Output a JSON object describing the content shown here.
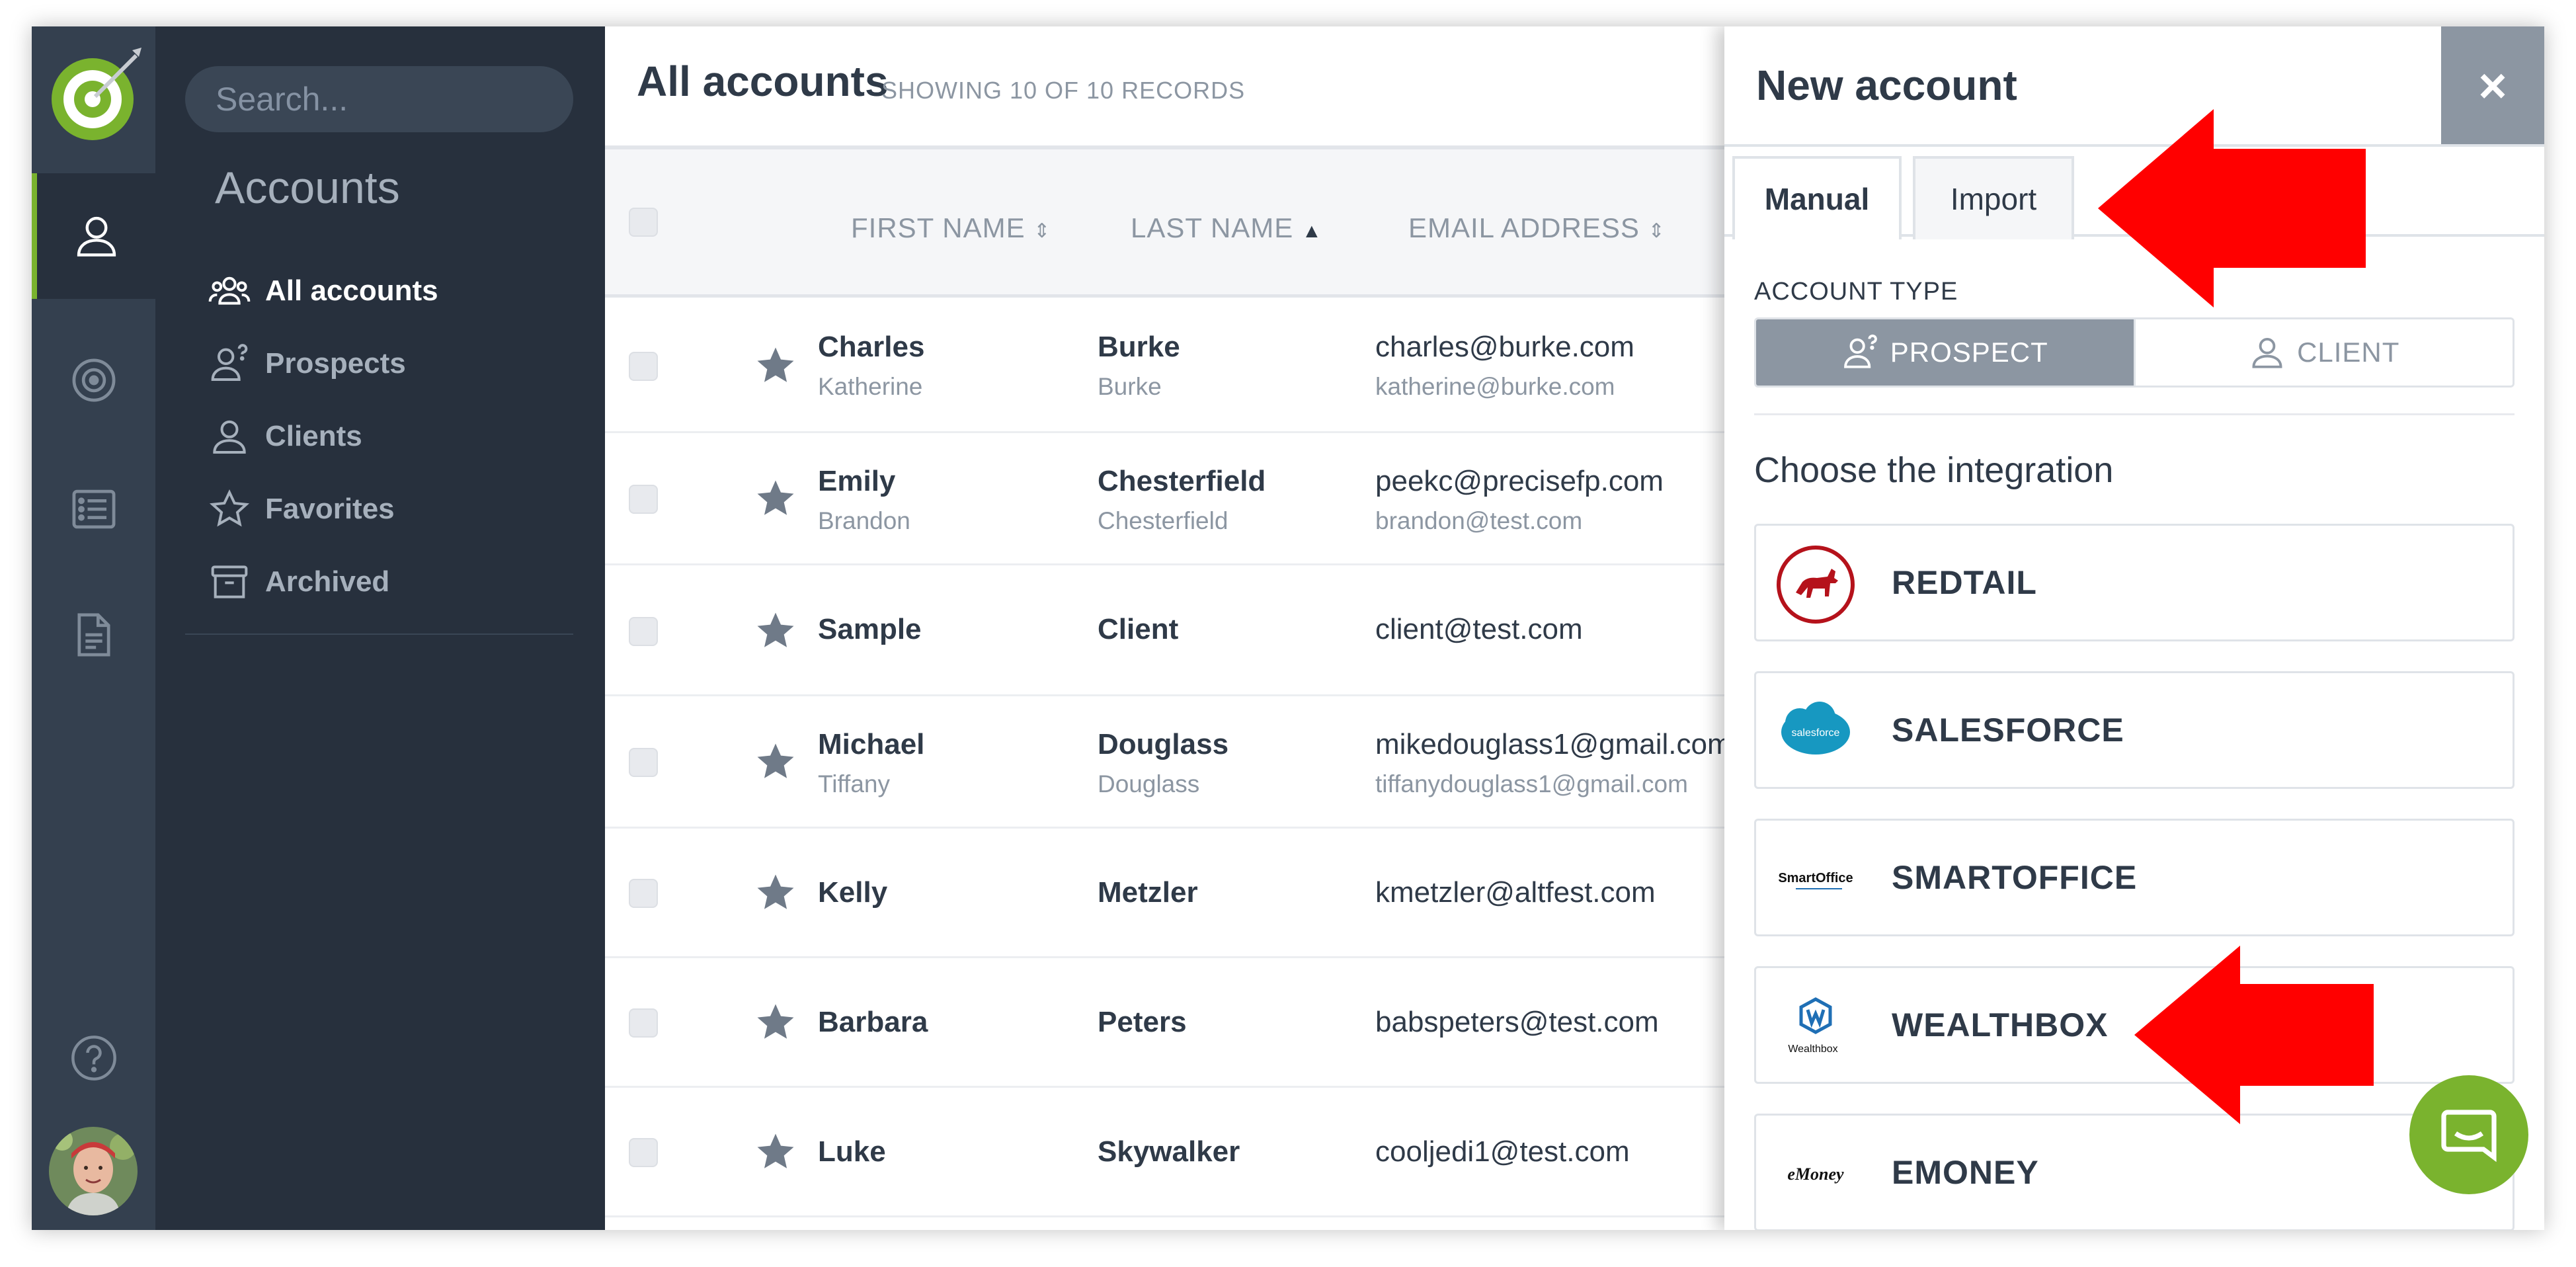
{
  "sidebar": {
    "search_placeholder": "Search...",
    "heading": "Accounts",
    "items": [
      {
        "label": "All accounts",
        "icon": "users-icon",
        "active": true
      },
      {
        "label": "Prospects",
        "icon": "prospect-icon",
        "active": false
      },
      {
        "label": "Clients",
        "icon": "user-icon",
        "active": false
      },
      {
        "label": "Favorites",
        "icon": "star-icon",
        "active": false
      },
      {
        "label": "Archived",
        "icon": "archive-icon",
        "active": false
      }
    ]
  },
  "rail": {
    "nav_icons": [
      "user-icon",
      "target-icon",
      "list-icon",
      "document-icon"
    ],
    "help_icon": "question-icon"
  },
  "main": {
    "title": "All accounts",
    "record_count": "SHOWING 10 OF 10 RECORDS",
    "columns": [
      "FIRST NAME",
      "LAST NAME",
      "EMAIL ADDRESS"
    ],
    "rows": [
      {
        "first": "Charles",
        "first_sub": "Katherine",
        "last": "Burke",
        "last_sub": "Burke",
        "email": "charles@burke.com",
        "email_sub": "katherine@burke.com"
      },
      {
        "first": "Emily",
        "first_sub": "Brandon",
        "last": "Chesterfield",
        "last_sub": "Chesterfield",
        "email": "peekc@precisefp.com",
        "email_sub": "brandon@test.com"
      },
      {
        "first": "Sample",
        "first_sub": "",
        "last": "Client",
        "last_sub": "",
        "email": "client@test.com",
        "email_sub": ""
      },
      {
        "first": "Michael",
        "first_sub": "Tiffany",
        "last": "Douglass",
        "last_sub": "Douglass",
        "email": "mikedouglass1@gmail.com",
        "email_sub": "tiffanydouglass1@gmail.com"
      },
      {
        "first": "Kelly",
        "first_sub": "",
        "last": "Metzler",
        "last_sub": "",
        "email": "kmetzler@altfest.com",
        "email_sub": ""
      },
      {
        "first": "Barbara",
        "first_sub": "",
        "last": "Peters",
        "last_sub": "",
        "email": "babspeters@test.com",
        "email_sub": ""
      },
      {
        "first": "Luke",
        "first_sub": "",
        "last": "Skywalker",
        "last_sub": "",
        "email": "cooljedi1@test.com",
        "email_sub": ""
      }
    ]
  },
  "panel": {
    "title": "New account",
    "close_label": "×",
    "tabs": [
      "Manual",
      "Import"
    ],
    "account_type_label": "ACCOUNT TYPE",
    "types": [
      "PROSPECT",
      "CLIENT"
    ],
    "choose_label": "Choose the integration",
    "integrations": [
      {
        "name": "REDTAIL"
      },
      {
        "name": "SALESFORCE",
        "logo_text": "salesforce"
      },
      {
        "name": "SMARTOFFICE",
        "logo_text": "SmartOffice"
      },
      {
        "name": "WEALTHBOX",
        "logo_text": "Wealthbox"
      },
      {
        "name": "EMONEY",
        "logo_text": "eMoney"
      }
    ]
  },
  "colors": {
    "rail": "#34404f",
    "sidebar": "#27303d",
    "accent": "#7ab32e",
    "arrow": "#ff0000",
    "text": "#2f3a48",
    "muted": "#8c96a2"
  }
}
